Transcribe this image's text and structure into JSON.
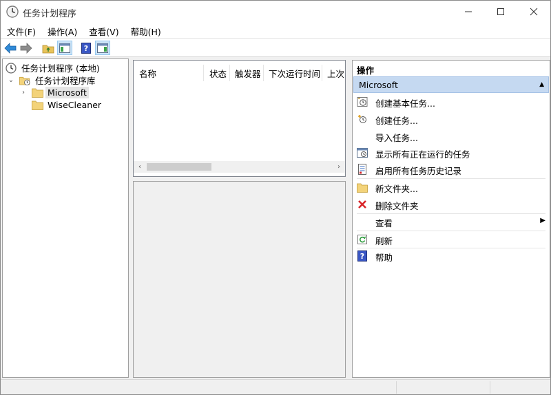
{
  "window": {
    "title": "任务计划程序"
  },
  "menu": [
    {
      "label": "文件(F)"
    },
    {
      "label": "操作(A)"
    },
    {
      "label": "查看(V)"
    },
    {
      "label": "帮助(H)"
    }
  ],
  "tree": {
    "root": "任务计划程序 (本地)",
    "library": "任务计划程序库",
    "folders": [
      "Microsoft",
      "WiseCleaner"
    ],
    "selected": "Microsoft"
  },
  "list": {
    "columns": [
      "名称",
      "状态",
      "触发器",
      "下次运行时间",
      "上次"
    ]
  },
  "actions": {
    "header": "操作",
    "section": "Microsoft",
    "items": [
      {
        "label": "创建基本任务...",
        "icon": "basic-task-icon"
      },
      {
        "label": "创建任务...",
        "icon": "create-task-icon"
      },
      {
        "label": "导入任务...",
        "icon": "none"
      },
      {
        "label": "显示所有正在运行的任务",
        "icon": "running-tasks-icon"
      },
      {
        "label": "启用所有任务历史记录",
        "icon": "history-icon"
      },
      {
        "label": "新文件夹...",
        "icon": "new-folder-icon"
      },
      {
        "label": "删除文件夹",
        "icon": "delete-icon"
      },
      {
        "label": "查看",
        "icon": "none"
      },
      {
        "label": "刷新",
        "icon": "refresh-icon"
      },
      {
        "label": "帮助",
        "icon": "help-icon"
      }
    ]
  },
  "colors": {
    "section_bg": "#c5d9f1",
    "delete_red": "#d9262a",
    "help_blue": "#3a57c4",
    "folder_yellow": "#f3d37a"
  }
}
